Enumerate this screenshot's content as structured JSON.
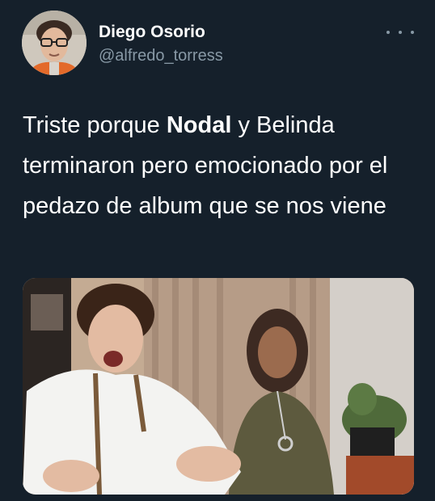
{
  "user": {
    "display_name": "Diego Osorio",
    "handle": "@alfredo_torress",
    "avatar_icon": "user-avatar-photo"
  },
  "menu": {
    "icon": "more-options-icon"
  },
  "tweet": {
    "text_part1": "Triste porque ",
    "text_bold": "Nodal",
    "text_part2": " y Belinda terminaron pero emocionado por el pedazo de album que se nos viene"
  },
  "media": {
    "icon": "tweet-image-photo"
  },
  "colors": {
    "background": "#15202b",
    "primary_text": "#ffffff",
    "secondary_text": "#8899a6"
  }
}
